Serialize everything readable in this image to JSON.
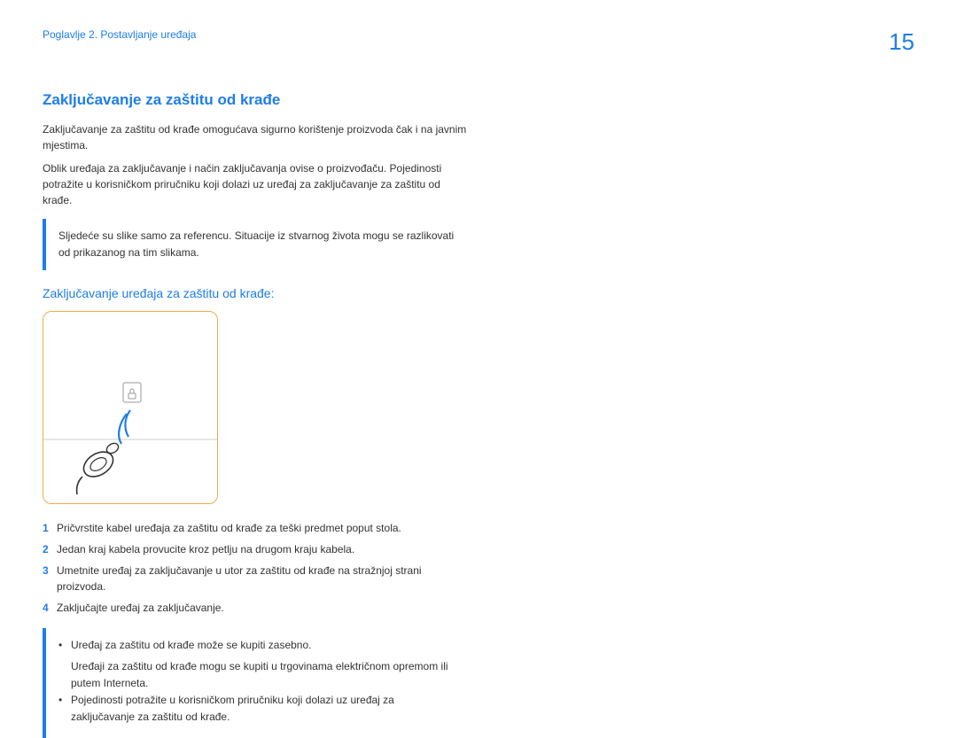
{
  "header": {
    "breadcrumb": "Poglavlje 2. Postavljanje uređaja",
    "page_number": "15"
  },
  "main": {
    "heading": "Zaključavanje za zaštitu od krađe",
    "para1": "Zaključavanje za zaštitu od krađe omogućava sigurno korištenje proizvoda čak i na javnim mjestima.",
    "para2": "Oblik uređaja za zaključavanje i način zaključavanja ovise o proizvođaču. Pojedinosti potražite u korisničkom priručniku koji dolazi uz uređaj za zaključavanje za zaštitu od krađe.",
    "note1": "Sljedeće su slike samo za referencu. Situacije iz stvarnog života mogu se razlikovati od prikazanog na tim slikama.",
    "subheading": "Zaključavanje uređaja za zaštitu od krađe:",
    "steps": [
      {
        "num": "1",
        "text": "Pričvrstite kabel uređaja za zaštitu od krađe za teški predmet poput stola."
      },
      {
        "num": "2",
        "text": "Jedan kraj kabela provucite kroz petlju na drugom kraju kabela."
      },
      {
        "num": "3",
        "text": "Umetnite uređaj za zaključavanje u utor za zaštitu od krađe na stražnjoj strani proizvoda."
      },
      {
        "num": "4",
        "text": "Zaključajte uređaj za zaključavanje."
      }
    ],
    "note2_bullet1": "Uređaj za zaštitu od krađe može se kupiti zasebno.",
    "note2_bullet1_sub": "Uređaji za zaštitu od krađe mogu se kupiti u trgovinama električnom opremom ili putem Interneta.",
    "note2_bullet2": "Pojedinosti potražite u korisničkom priručniku koji dolazi uz uređaj za zaključavanje za zaštitu od krađe."
  }
}
